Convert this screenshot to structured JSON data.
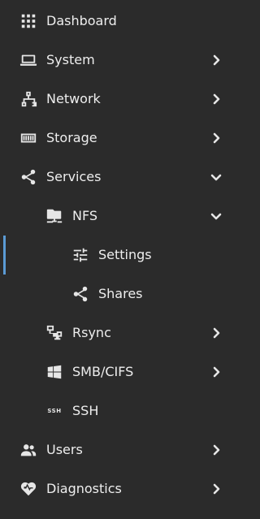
{
  "colors": {
    "background": "#2b2b2b",
    "text": "#eeeeee",
    "active_indicator": "#5b9bd5"
  },
  "menu": {
    "dashboard": {
      "label": "Dashboard",
      "icon": "dashboard-grid-icon"
    },
    "system": {
      "label": "System",
      "icon": "laptop-icon",
      "expanded": false
    },
    "network": {
      "label": "Network",
      "icon": "network-icon",
      "expanded": false
    },
    "storage": {
      "label": "Storage",
      "icon": "storage-icon",
      "expanded": false
    },
    "services": {
      "label": "Services",
      "icon": "share-icon",
      "expanded": true
    },
    "nfs": {
      "label": "NFS",
      "icon": "folder-network-icon",
      "expanded": true
    },
    "nfs_settings": {
      "label": "Settings",
      "icon": "tune-icon",
      "active": true
    },
    "nfs_shares": {
      "label": "Shares",
      "icon": "share-icon"
    },
    "rsync": {
      "label": "Rsync",
      "icon": "lan-icon",
      "expanded": false
    },
    "smb": {
      "label": "SMB/CIFS",
      "icon": "windows-icon",
      "expanded": false
    },
    "ssh": {
      "label": "SSH",
      "icon": "ssh-icon",
      "icon_text": "SSH"
    },
    "users": {
      "label": "Users",
      "icon": "users-icon",
      "expanded": false
    },
    "diagnostics": {
      "label": "Diagnostics",
      "icon": "heart-pulse-icon",
      "expanded": false
    }
  }
}
